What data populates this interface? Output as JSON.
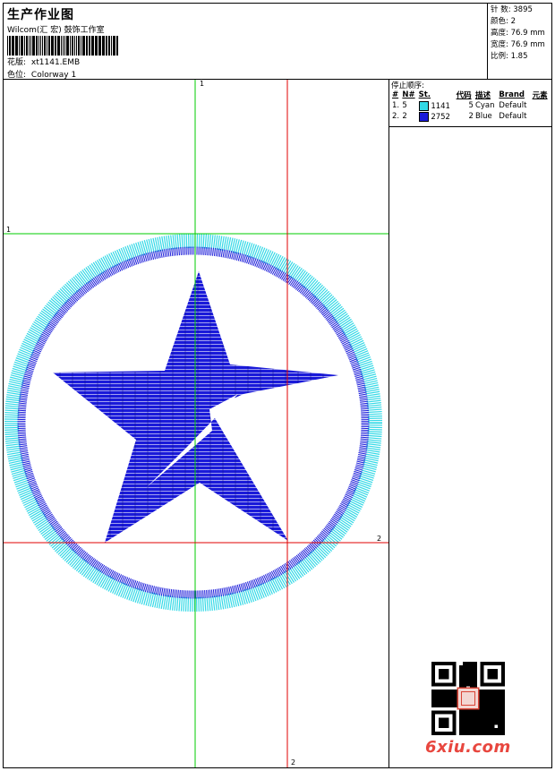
{
  "header": {
    "title": "生产作业图",
    "company": "Wilcom(汇 宏) 鼓饰工作室",
    "design_label": "花版:",
    "design_file": "xt1141.EMB",
    "colorway_label": "色位:",
    "colorway": "Colorway 1"
  },
  "stats": {
    "stitches": "针 数: 3895",
    "colors": "颜色: 2",
    "height": "高度: 76.9 mm",
    "width": "宽度: 76.9 mm",
    "scale": "比例: 1.85"
  },
  "stop_sequence": {
    "title": "停止顺序:",
    "columns": [
      "#",
      "N#",
      "St.",
      "代码",
      "描述",
      "Brand",
      "元素"
    ],
    "rows": [
      {
        "num": "1.",
        "needle": "5",
        "color": "#33d9e6",
        "stitches": "1141",
        "code": "5",
        "desc": "Cyan",
        "brand": "Default"
      },
      {
        "num": "2.",
        "needle": "2",
        "color": "#1a1ad9",
        "stitches": "2752",
        "code": "2",
        "desc": "Blue",
        "brand": "Default"
      }
    ]
  },
  "guides": {
    "v1": "1",
    "h1": "1",
    "h2": "2",
    "v2": "2"
  },
  "watermark": "6xiu.com",
  "colors": {
    "cyan": "#33d9e6",
    "blue": "#1a1ad9",
    "green": "#00cc00",
    "red": "#e00000"
  }
}
